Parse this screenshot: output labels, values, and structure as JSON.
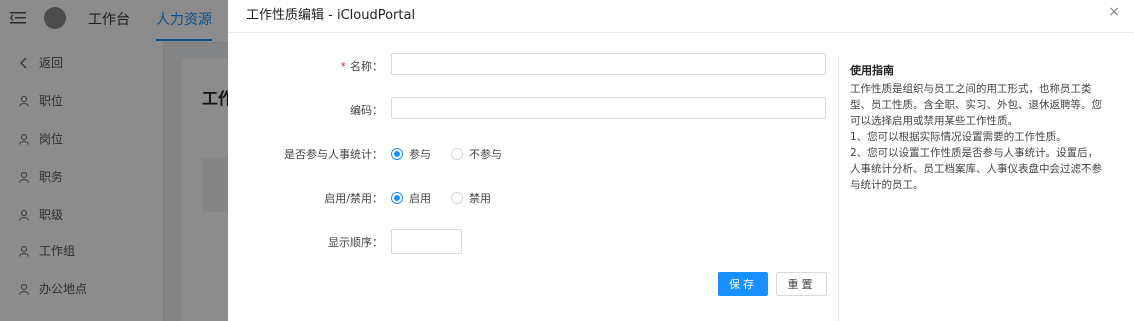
{
  "topbar": {
    "nav": [
      "工作台",
      "人力资源"
    ]
  },
  "sidebar": {
    "items": [
      "返回",
      "职位",
      "岗位",
      "职务",
      "职级",
      "工作组",
      "办公地点"
    ]
  },
  "background": {
    "title": "工作"
  },
  "drawer": {
    "title": "工作性质编辑 - iCloudPortal",
    "close": "×",
    "form": {
      "name_label": "名称：",
      "name_value": "",
      "code_label": "编码：",
      "code_value": "",
      "stat_label": "是否参与人事统计：",
      "stat_options": [
        "参与",
        "不参与"
      ],
      "stat_selected": "参与",
      "enable_label": "启用/禁用：",
      "enable_options": [
        "启用",
        "禁用"
      ],
      "enable_selected": "启用",
      "order_label": "显示顺序：",
      "order_value": ""
    },
    "buttons": {
      "save": "保存",
      "reset": "重置"
    },
    "guide": {
      "title": "使用指南",
      "lines": [
        "工作性质是组织与员工之间的用工形式，也称员工类",
        "型、员工性质。含全职、实习、外包、退休返聘等。您",
        "可以选择启用或禁用某些工作性质。",
        "1、您可以根据实际情况设置需要的工作性质。",
        "2、您可以设置工作性质是否参与人事统计。设置后，",
        "人事统计分析、员工档案库、人事仪表盘中会过滤不参",
        "与统计的员工。"
      ]
    }
  },
  "colors": {
    "accent": "#1890ff",
    "required": "#f5222d",
    "mask": "rgba(0,0,0,0.45)"
  },
  "icons": [
    "menu-icon",
    "logo-icon",
    "back-chevron-icon",
    "user-icon",
    "close-icon"
  ]
}
